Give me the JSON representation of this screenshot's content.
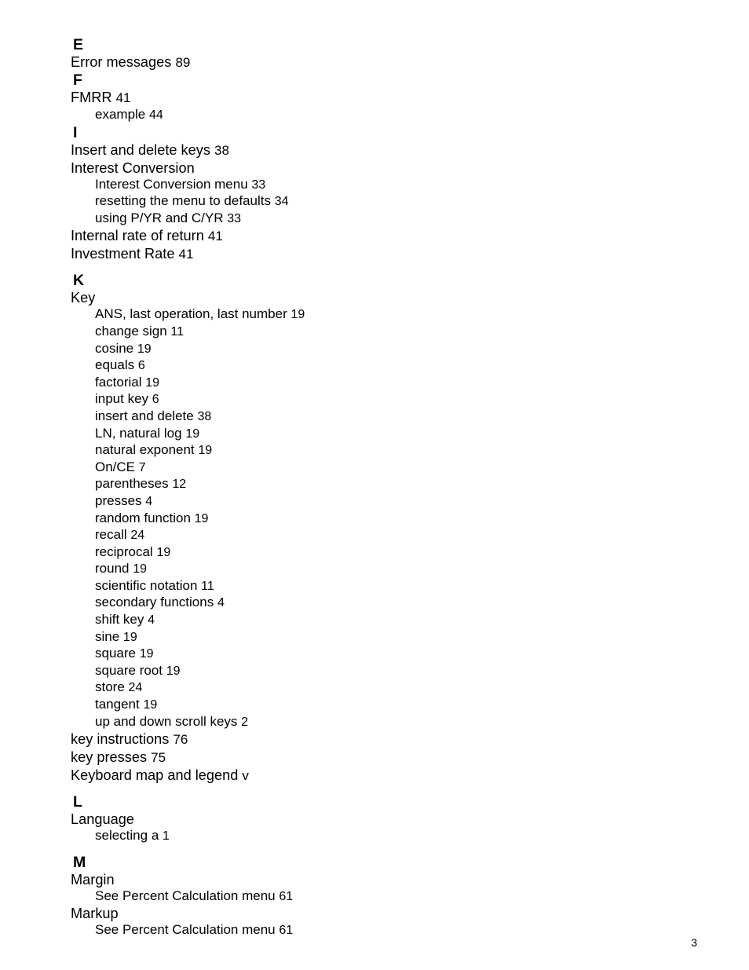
{
  "page": {
    "folio": "3",
    "document_type": "index"
  },
  "sections": [
    {
      "letter": "E",
      "spacing": "tight",
      "entries": [
        {
          "label": "Error messages",
          "page": "89",
          "subentries": []
        }
      ]
    },
    {
      "letter": "F",
      "spacing": "tight",
      "entries": [
        {
          "label": "FMRR",
          "page": "41",
          "subentries": [
            {
              "label": "example",
              "page": "44"
            }
          ]
        }
      ]
    },
    {
      "letter": "I",
      "spacing": "tight",
      "entries": [
        {
          "label": "Insert and delete keys",
          "page": "38",
          "subentries": []
        },
        {
          "label": "Interest Conversion",
          "page": "",
          "subentries": [
            {
              "label": "Interest Conversion menu",
              "page": "33"
            },
            {
              "label": "resetting the menu to defaults",
              "page": "34"
            },
            {
              "label": "using P/YR and C/YR",
              "page": "33"
            }
          ]
        },
        {
          "label": "Internal rate of return",
          "page": "41",
          "subentries": []
        },
        {
          "label": "Investment Rate",
          "page": "41",
          "subentries": []
        }
      ]
    },
    {
      "letter": "K",
      "spacing": "spaced",
      "entries": [
        {
          "label": "Key",
          "page": "",
          "subentries": [
            {
              "label": "ANS, last operation, last number",
              "page": "19"
            },
            {
              "label": "change sign",
              "page": "11"
            },
            {
              "label": "cosine",
              "page": "19"
            },
            {
              "label": "equals",
              "page": "6"
            },
            {
              "label": "factorial",
              "page": "19"
            },
            {
              "label": "input key",
              "page": "6"
            },
            {
              "label": "insert and delete",
              "page": "38"
            },
            {
              "label": "LN, natural log",
              "page": "19"
            },
            {
              "label": "natural exponent",
              "page": "19"
            },
            {
              "label": "On/CE",
              "page": "7"
            },
            {
              "label": "parentheses",
              "page": "12"
            },
            {
              "label": "presses",
              "page": "4"
            },
            {
              "label": "random function",
              "page": "19"
            },
            {
              "label": "recall",
              "page": "24"
            },
            {
              "label": "reciprocal",
              "page": "19"
            },
            {
              "label": "round",
              "page": "19"
            },
            {
              "label": "scientific notation",
              "page": "11"
            },
            {
              "label": "secondary functions",
              "page": "4"
            },
            {
              "label": "shift key",
              "page": "4"
            },
            {
              "label": "sine",
              "page": "19"
            },
            {
              "label": "square",
              "page": "19"
            },
            {
              "label": "square root",
              "page": "19"
            },
            {
              "label": "store",
              "page": "24"
            },
            {
              "label": "tangent",
              "page": "19"
            },
            {
              "label": "up and down scroll keys",
              "page": "2"
            }
          ]
        },
        {
          "label": "key instructions",
          "page": "76",
          "subentries": []
        },
        {
          "label": "key presses",
          "page": "75",
          "subentries": []
        },
        {
          "label": "Keyboard map and legend",
          "page": "v",
          "subentries": []
        }
      ]
    },
    {
      "letter": "L",
      "spacing": "spaced",
      "entries": [
        {
          "label": "Language",
          "page": "",
          "subentries": [
            {
              "label": "selecting a",
              "page": "1"
            }
          ]
        }
      ]
    },
    {
      "letter": "M",
      "spacing": "spaced",
      "entries": [
        {
          "label": "Margin",
          "page": "",
          "subentries": [
            {
              "label": "See Percent Calculation menu",
              "page": "61"
            }
          ]
        },
        {
          "label": "Markup",
          "page": "",
          "subentries": [
            {
              "label": "See Percent Calculation menu",
              "page": "61"
            }
          ]
        }
      ]
    }
  ]
}
